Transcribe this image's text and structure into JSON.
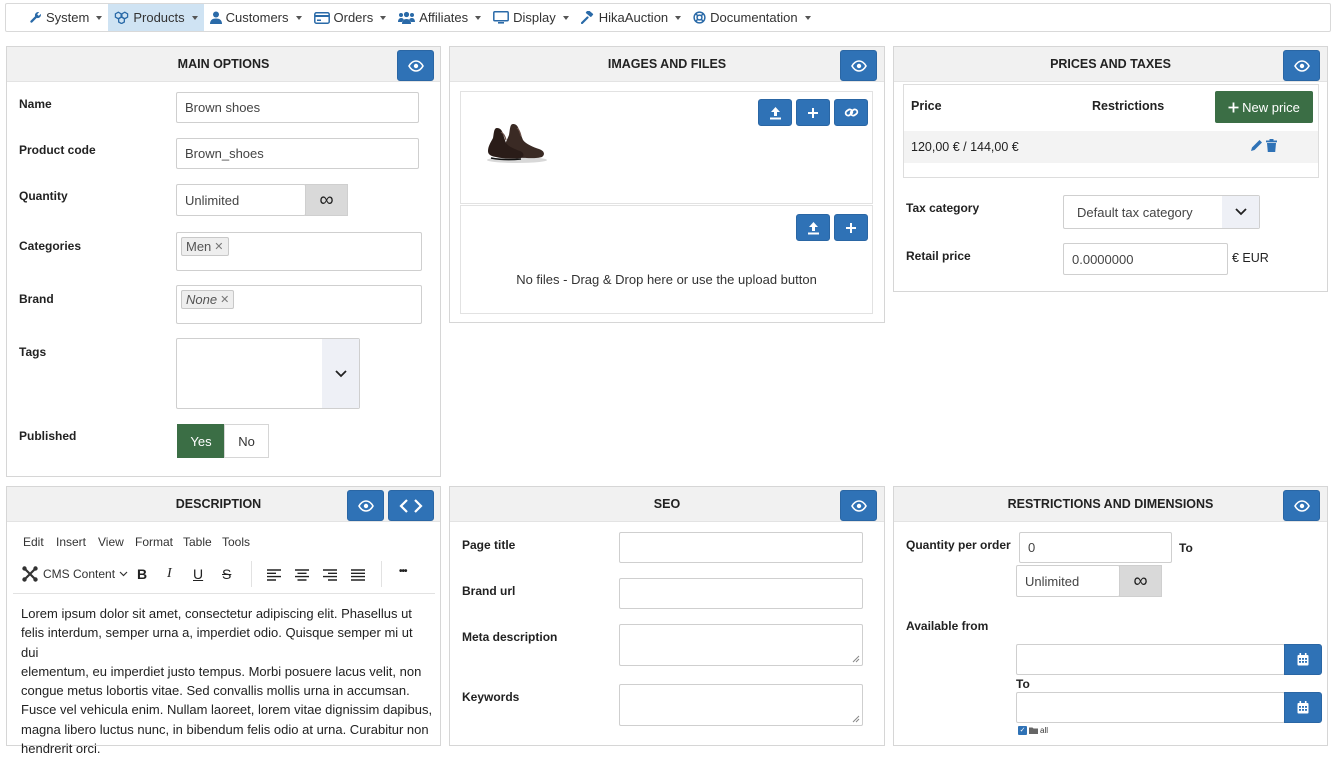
{
  "nav": {
    "items": [
      {
        "label": "System",
        "icon": "wrench-icon"
      },
      {
        "label": "Products",
        "icon": "cubes-icon",
        "active": true
      },
      {
        "label": "Customers",
        "icon": "user-icon"
      },
      {
        "label": "Orders",
        "icon": "credit-card-icon"
      },
      {
        "label": "Affiliates",
        "icon": "users-icon"
      },
      {
        "label": "Display",
        "icon": "monitor-icon"
      },
      {
        "label": "HikaAuction",
        "icon": "gavel-icon"
      },
      {
        "label": "Documentation",
        "icon": "lifebuoy-icon"
      }
    ]
  },
  "main_options": {
    "title": "MAIN OPTIONS",
    "name_label": "Name",
    "name_value": "Brown shoes",
    "code_label": "Product code",
    "code_value": "Brown_shoes",
    "quantity_label": "Quantity",
    "quantity_value": "Unlimited",
    "infinity": "∞",
    "categories_label": "Categories",
    "category_chip": "Men",
    "brand_label": "Brand",
    "brand_chip": "None",
    "tags_label": "Tags",
    "published_label": "Published",
    "yes": "Yes",
    "no": "No"
  },
  "images": {
    "title": "IMAGES AND FILES",
    "no_files": "No files - Drag & Drop here or use the upload button"
  },
  "prices": {
    "title": "PRICES AND TAXES",
    "col_price": "Price",
    "col_restrictions": "Restrictions",
    "new_price": "New price",
    "row_price": "120,00 € / 144,00 €",
    "tax_label": "Tax category",
    "tax_value": "Default tax category",
    "retail_label": "Retail price",
    "retail_value": "0.0000000",
    "currency": "€ EUR"
  },
  "description": {
    "title": "DESCRIPTION",
    "menu": [
      "Edit",
      "Insert",
      "View",
      "Format",
      "Table",
      "Tools"
    ],
    "cms_content": "CMS Content",
    "bold": "B",
    "italic": "I",
    "underline": "U",
    "strike": "S",
    "more": "•••",
    "lines": [
      "Lorem ipsum dolor sit amet, consectetur adipiscing elit. Phasellus ut",
      "felis interdum, semper urna a, imperdiet odio. Quisque semper mi ut dui",
      "elementum, eu imperdiet justo tempus. Morbi posuere lacus velit, non",
      "congue metus lobortis vitae. Sed convallis mollis urna in accumsan.",
      "Fusce vel vehicula enim. Nullam laoreet, lorem vitae dignissim dapibus,",
      "magna libero luctus nunc, in bibendum felis odio at urna. Curabitur non",
      "hendrerit orci."
    ]
  },
  "seo": {
    "title": "SEO",
    "page_title_label": "Page title",
    "brand_url_label": "Brand url",
    "meta_label": "Meta description",
    "keywords_label": "Keywords"
  },
  "restrictions": {
    "title": "RESTRICTIONS AND DIMENSIONS",
    "qty_label": "Quantity per order",
    "qty_min": "0",
    "to1": "To",
    "qty_max": "Unlimited",
    "infinity": "∞",
    "available_label": "Available from",
    "to2": "To",
    "all_label": "all"
  },
  "colors": {
    "primary": "#2f72b6",
    "success": "#3b6e45",
    "nav_active": "#cfe3f3"
  }
}
